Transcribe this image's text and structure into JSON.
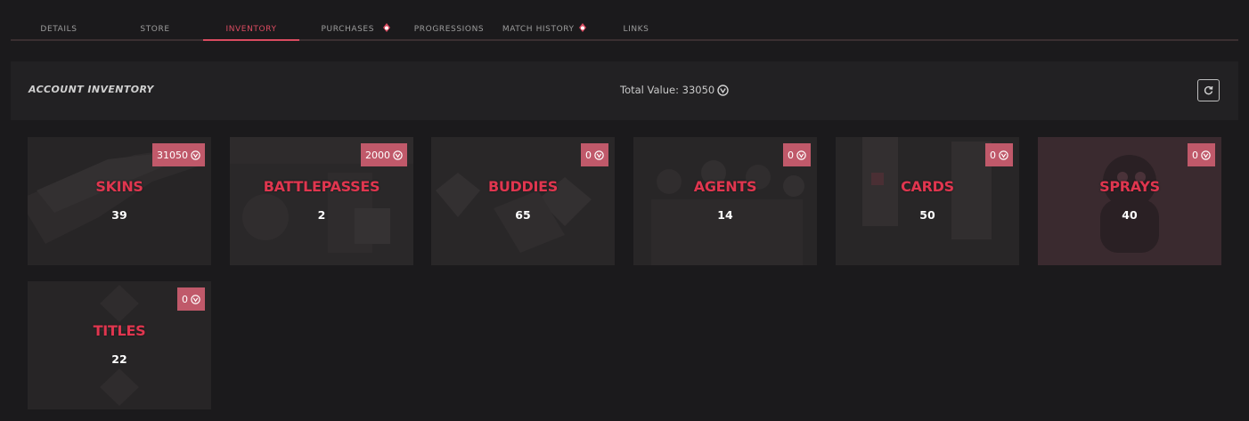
{
  "tabs": [
    {
      "label": "DETAILS",
      "vp": false
    },
    {
      "label": "STORE",
      "vp": false
    },
    {
      "label": "INVENTORY",
      "vp": false,
      "active": true
    },
    {
      "label": "PURCHASES",
      "vp": true
    },
    {
      "label": "PROGRESSIONS",
      "vp": false
    },
    {
      "label": "MATCH HISTORY",
      "vp": true
    },
    {
      "label": "LINKS",
      "vp": false
    }
  ],
  "header": {
    "title": "ACCOUNT INVENTORY",
    "total_label": "Total Value: 33050"
  },
  "colors": {
    "accent": "#d94b60",
    "badge": "#c0596a",
    "card_title": "#e0364f"
  },
  "cards": [
    {
      "name": "SKINS",
      "count": "39",
      "value": "31050",
      "bg_icon": "rifle-icon"
    },
    {
      "name": "BATTLEPASSES",
      "count": "2",
      "value": "2000",
      "bg_icon": "battlepass-art"
    },
    {
      "name": "BUDDIES",
      "count": "65",
      "value": "0",
      "bg_icon": "buddy-charms-art"
    },
    {
      "name": "AGENTS",
      "count": "14",
      "value": "0",
      "bg_icon": "agents-group-art"
    },
    {
      "name": "CARDS",
      "count": "50",
      "value": "0",
      "bg_icon": "player-cards-art"
    },
    {
      "name": "SPRAYS",
      "count": "40",
      "value": "0",
      "bg_icon": "spray-art"
    },
    {
      "name": "TITLES",
      "count": "22",
      "value": "0",
      "bg_icon": "titles-emblem-art"
    }
  ]
}
